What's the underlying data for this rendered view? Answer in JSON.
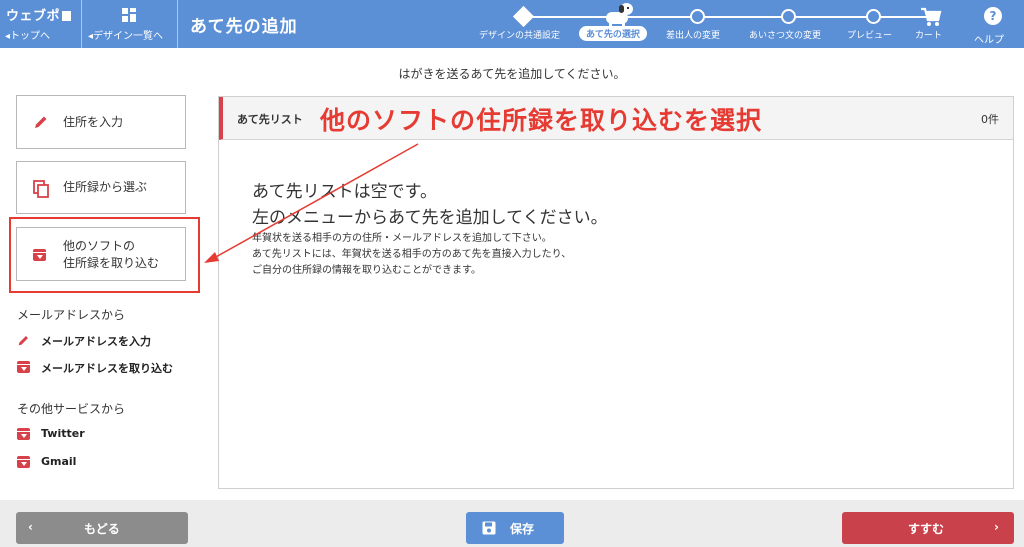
{
  "header": {
    "logo": "ウェブポ",
    "top_link": "トップへ",
    "design_link": "デザイン一覧へ",
    "title": "あて先の追加",
    "steps": [
      {
        "label": "デザインの共通設定"
      },
      {
        "label": "あて先の選択",
        "active": true
      },
      {
        "label": "差出人の変更"
      },
      {
        "label": "あいさつ文の変更"
      },
      {
        "label": "プレビュー"
      },
      {
        "label": "カート"
      }
    ],
    "help": "ヘルプ"
  },
  "instruction": "はがきを送るあて先を追加してください。",
  "menu": {
    "input_address": "住所を入力",
    "choose_from_book": "住所録から選ぶ",
    "import_line1": "他のソフトの",
    "import_line2": "住所録を取り込む",
    "mail_section": "メールアドレスから",
    "mail_input": "メールアドレスを入力",
    "mail_import": "メールアドレスを取り込む",
    "other_section": "その他サービスから",
    "twitter": "Twitter",
    "gmail": "Gmail"
  },
  "panel": {
    "label": "あて先リスト",
    "count": "0件",
    "empty_line1": "あて先リストは空です。",
    "empty_line2": "左のメニューからあて先を追加してください。",
    "desc1": "年賀状を送る相手の方の住所・メールアドレスを追加して下さい。",
    "desc2": "あて先リストには、年賀状を送る相手の方のあて先を直接入力したり、",
    "desc3": "ご自分の住所録の情報を取り込むことができます。"
  },
  "annotation": "他のソフトの住所録を取り込むを選択",
  "footer": {
    "back": "もどる",
    "save": "保存",
    "next": "すすむ"
  },
  "colors": {
    "header": "#5b8fd6",
    "accent_red": "#d8414a",
    "annotation": "#e53b32",
    "save": "#5b8fd6",
    "back": "#8c8c8c",
    "next": "#c9414a"
  }
}
